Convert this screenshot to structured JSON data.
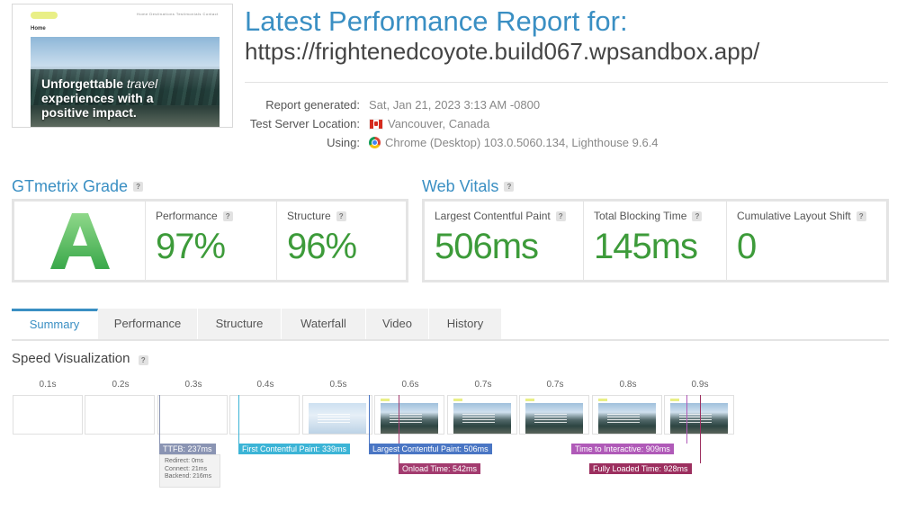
{
  "preview": {
    "nav": "Home  Destinations  Testimonials  Contact",
    "home": "Home",
    "hero_line1_a": "Unforgettable ",
    "hero_line1_b": "travel",
    "hero_line2": "experiences with a",
    "hero_line3": "positive impact."
  },
  "report": {
    "title": "Latest Performance Report for:",
    "url": "https://frightenedcoyote.build067.wpsandbox.app/",
    "generated_label": "Report generated:",
    "generated_value": "Sat, Jan 21, 2023 3:13 AM -0800",
    "location_label": "Test Server Location:",
    "location_value": "Vancouver, Canada",
    "using_label": "Using:",
    "using_value": "Chrome (Desktop) 103.0.5060.134, Lighthouse 9.6.4"
  },
  "grade": {
    "title": "GTmetrix Grade",
    "letter": "A",
    "performance_label": "Performance",
    "performance_value": "97%",
    "structure_label": "Structure",
    "structure_value": "96%"
  },
  "vitals": {
    "title": "Web Vitals",
    "lcp_label": "Largest Contentful Paint",
    "lcp_value": "506ms",
    "tbt_label": "Total Blocking Time",
    "tbt_value": "145ms",
    "cls_label": "Cumulative Layout Shift",
    "cls_value": "0"
  },
  "tabs": [
    {
      "label": "Summary",
      "active": true
    },
    {
      "label": "Performance"
    },
    {
      "label": "Structure"
    },
    {
      "label": "Waterfall"
    },
    {
      "label": "Video"
    },
    {
      "label": "History"
    }
  ],
  "speed": {
    "title": "Speed Visualization",
    "ticks": [
      "0.1s",
      "0.2s",
      "0.3s",
      "0.4s",
      "0.5s",
      "0.6s",
      "0.7s",
      "0.7s",
      "0.8s",
      "0.9s"
    ],
    "ttfb": "TTFB: 237ms",
    "redirect": "Redirect: 0ms",
    "connect": "Connect: 21ms",
    "backend": "Backend: 216ms",
    "fcp": "First Contentful Paint: 339ms",
    "lcp": "Largest Contentful Paint: 506ms",
    "onload": "Onload Time: 542ms",
    "tti": "Time to Interactive: 909ms",
    "fully_loaded": "Fully Loaded Time: 928ms"
  },
  "colors": {
    "accent": "#3a8fc3",
    "good": "#3d9b3a",
    "ttfb": "#8a94b3",
    "fcp": "#3cb4d6",
    "lcp": "#4a76c4",
    "onload": "#a33b6f",
    "tti": "#b05ab8",
    "fully_loaded": "#9c2f5f"
  },
  "icons": {
    "help": "question-mark-icon",
    "flag": "canada-flag-icon",
    "browser": "chrome-icon"
  }
}
